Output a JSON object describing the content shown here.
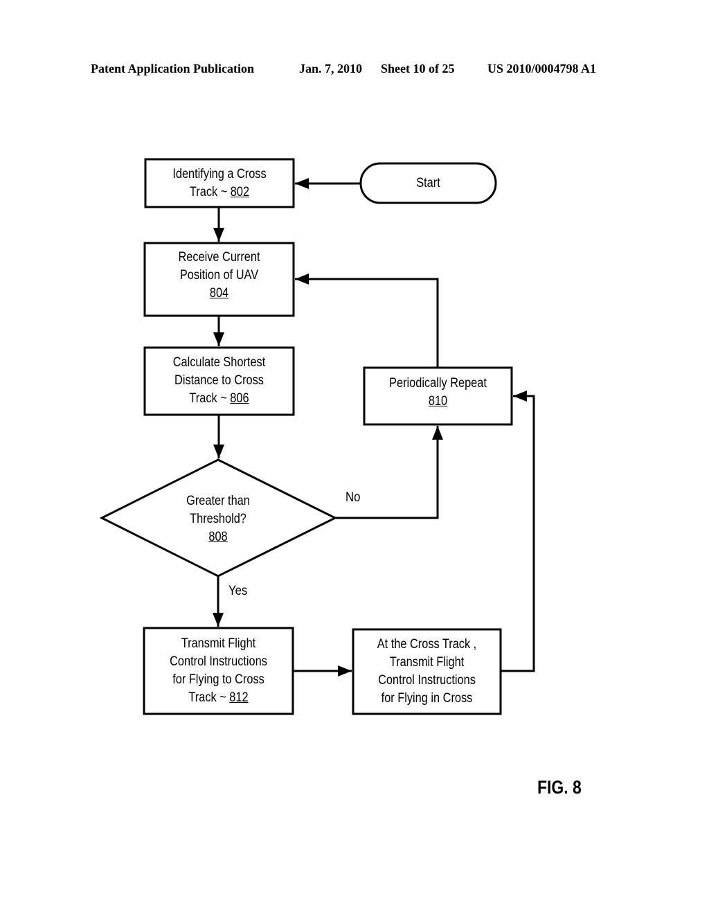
{
  "header": {
    "publication": "Patent Application Publication",
    "date": "Jan. 7, 2010",
    "sheet": "Sheet 10 of 25",
    "number": "US 2010/0004798 A1"
  },
  "figure": {
    "label": "FIG. 8",
    "nodes": {
      "start": {
        "text": "Start"
      },
      "n802": {
        "lines": [
          "Identifying a Cross",
          "Track ~ "
        ],
        "ref": "802"
      },
      "n804": {
        "lines": [
          "Receive Current",
          "Position of UAV"
        ],
        "ref": "804"
      },
      "n806": {
        "lines": [
          "Calculate Shortest",
          "Distance to Cross",
          "Track ~ "
        ],
        "ref": "806"
      },
      "n808": {
        "lines": [
          "Greater than",
          "Threshold?"
        ],
        "ref": "808"
      },
      "n810": {
        "lines": [
          "Periodically Repeat"
        ],
        "ref": "810"
      },
      "n812": {
        "lines": [
          "Transmit Flight",
          "Control Instructions",
          "for Flying to Cross",
          "Track ~ "
        ],
        "ref": "812"
      },
      "n814": {
        "lines": [
          "At the Cross Track ,",
          "Transmit Flight",
          "Control Instructions",
          "for Flying in Cross"
        ]
      }
    },
    "edge_labels": {
      "no": "No",
      "yes": "Yes"
    }
  }
}
